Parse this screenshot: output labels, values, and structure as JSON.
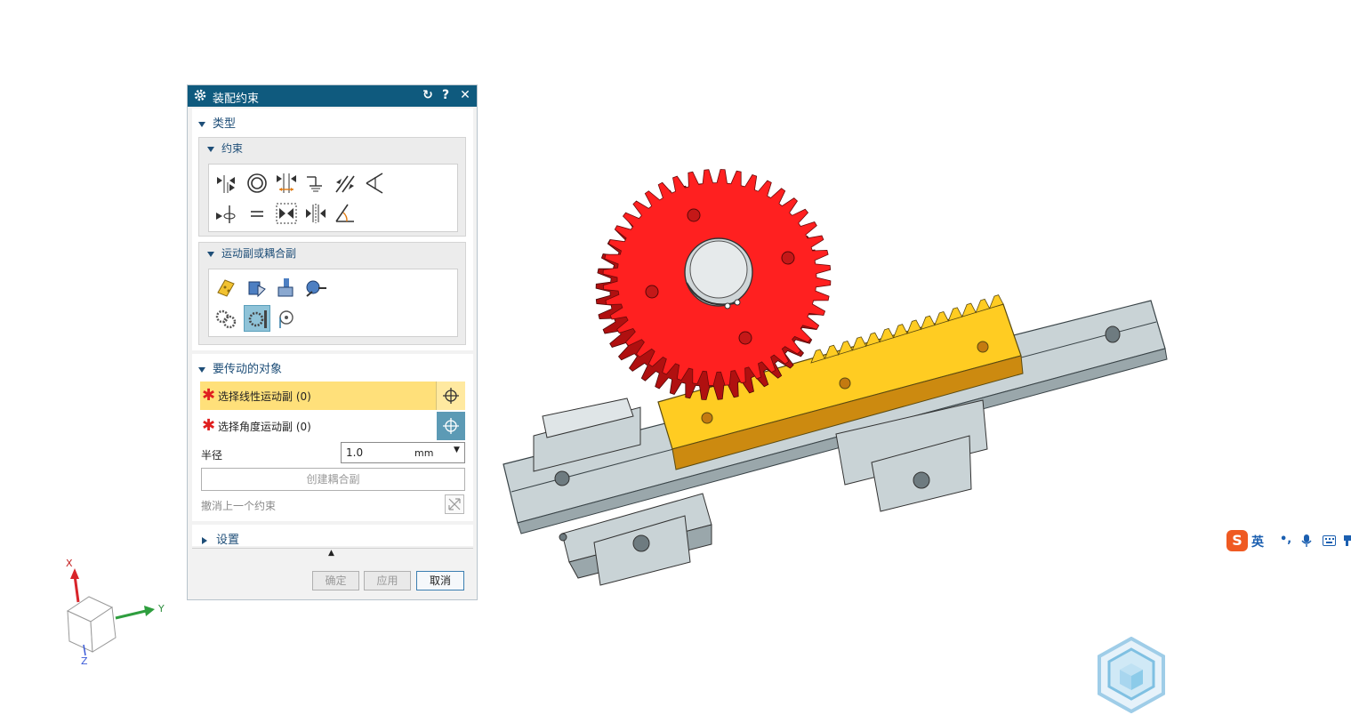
{
  "dialog": {
    "title": "装配约束",
    "type_section": "类型",
    "constraint_group": "约束",
    "motion_group": "运动副或耦合副",
    "objects_section": "要传动的对象",
    "select_linear": "选择线性运动副 (0)",
    "select_angular": "选择角度运动副 (0)",
    "radius_label": "半径",
    "radius_value": "1.0",
    "radius_unit": "mm",
    "create_coupler": "创建耦合副",
    "undo_last": "撤消上一个约束",
    "settings_section": "设置",
    "ok": "确定",
    "apply": "应用",
    "cancel": "取消"
  },
  "triad": {
    "x": "X",
    "y": "Y",
    "z": "Z"
  },
  "ime": {
    "mode": "英",
    "punct": "•,"
  },
  "colors": {
    "title_bar": "#0f5a7e",
    "selection_highlight": "#ffe07a",
    "gear": "#ff2020",
    "rack": "#ffcc22",
    "rail": "#c9d3d6"
  },
  "constraint_icons": [
    "touch-align-icon",
    "concentric-icon",
    "distance-icon",
    "fix-icon",
    "parallel-icon",
    "perpendicular-icon",
    "align-lock-icon",
    "fit-icon",
    "bond-icon",
    "center-icon",
    "angle-icon"
  ],
  "motion_icons": [
    "hinge-joint-icon",
    "slider-joint-icon",
    "cylindrical-joint-icon",
    "ball-joint-icon",
    "gear-coupler-icon",
    "rack-pinion-coupler-icon",
    "cable-coupler-icon"
  ]
}
